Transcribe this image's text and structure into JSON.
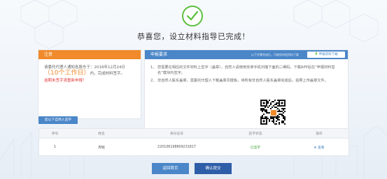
{
  "success": {
    "title": "恭喜您，设立材料指导已完成！"
  },
  "notice": {
    "header": "注意",
    "text_prefix": "请委托代理人通知各股东于：2018年12月24日",
    "highlight": "（10个工作日）",
    "text_suffix": "内，完成材料签字。",
    "warning": "逾期未签字清重新申报！"
  },
  "requirements": {
    "header": "申报要求",
    "hint": "以下步骤完成后，可继续申报资料下载",
    "download_label": "申报资料下载",
    "items": [
      {
        "num": "1、",
        "text": "您需要在相应的文件材料上签字（盖章），自然人请使用安卓手机扫描下面的二维码，下载APP后在“申报材料签名”模块内签字。"
      },
      {
        "num": "2、",
        "text": "非自然人股东盖章，需委托代理人下载盖章页模板，待所有非自然人股东盖章完成后，拍照上传盖章文件。"
      }
    ]
  },
  "sign_button": "您以下自然人签字",
  "table": {
    "headers": [
      "序号",
      "姓名",
      "身份证号",
      "签字状态",
      "操作"
    ],
    "rows": [
      {
        "index": "1",
        "name": "周铭",
        "id": "220106198809231817",
        "status": "已签字",
        "action": "查看"
      }
    ]
  },
  "buttons": {
    "back": "返回首页",
    "confirm": "确认提交"
  },
  "colors": {
    "orange": "#f08a2a",
    "blue": "#4a86c8",
    "green": "#5cbf3f",
    "dark_blue": "#2f5ea8"
  }
}
